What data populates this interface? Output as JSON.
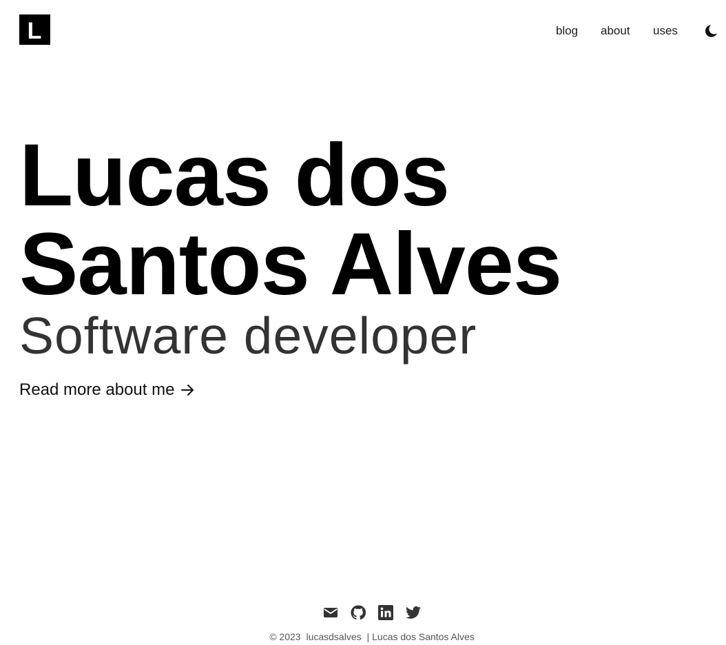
{
  "header": {
    "logo_letter": "L",
    "nav": [
      {
        "label": "blog"
      },
      {
        "label": "about"
      },
      {
        "label": "uses"
      }
    ],
    "theme_toggle_icon": "moon-icon"
  },
  "hero": {
    "name_line1": "Lucas dos",
    "name_line2": "Santos Alves",
    "subtitle": "Software developer",
    "read_more": "Read more about me",
    "read_more_icon": "arrow-right-icon"
  },
  "footer": {
    "social_icons": [
      "mail-icon",
      "github-icon",
      "linkedin-icon",
      "twitter-icon"
    ],
    "copyright": "© 2023",
    "handle": "lucasdsalves",
    "separator": "|",
    "name": "Lucas dos Santos Alves"
  }
}
